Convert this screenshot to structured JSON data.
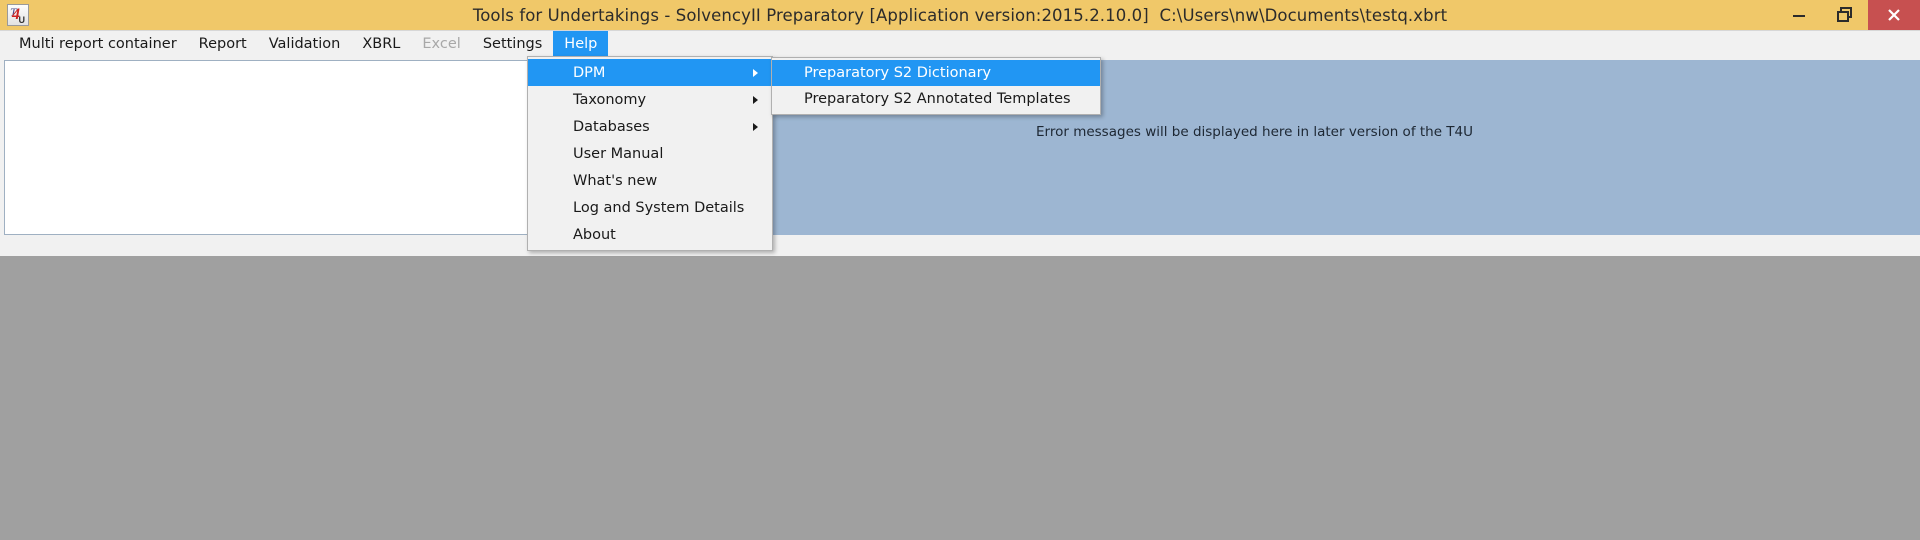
{
  "window": {
    "title": "Tools for Undertakings - SolvencyII Preparatory [Application version:2015.2.10.0]  C:\\Users\\nw\\Documents\\testq.xbrt",
    "icon_name": "t4u-app-icon",
    "icon_letters": {
      "t": "T",
      "four": "4",
      "u": "U"
    },
    "titlebar_color": "#f0c869",
    "controls": {
      "minimize_label": "Minimize",
      "restore_label": "Restore",
      "close_label": "Close",
      "close_color": "#c75050"
    }
  },
  "menubar": {
    "items": [
      {
        "label": "Multi report container",
        "state": "normal"
      },
      {
        "label": "Report",
        "state": "normal"
      },
      {
        "label": "Validation",
        "state": "normal"
      },
      {
        "label": "XBRL",
        "state": "normal"
      },
      {
        "label": "Excel",
        "state": "disabled"
      },
      {
        "label": "Settings",
        "state": "normal"
      },
      {
        "label": "Help",
        "state": "active"
      }
    ],
    "accent_color": "#2196f3"
  },
  "help_menu": {
    "items": [
      {
        "label": "DPM",
        "has_submenu": true,
        "highlighted": true
      },
      {
        "label": "Taxonomy",
        "has_submenu": true,
        "highlighted": false
      },
      {
        "label": "Databases",
        "has_submenu": true,
        "highlighted": false
      },
      {
        "label": "User Manual",
        "has_submenu": false,
        "highlighted": false
      },
      {
        "label": "What's new",
        "has_submenu": false,
        "highlighted": false
      },
      {
        "label": "Log and System Details",
        "has_submenu": false,
        "highlighted": false
      },
      {
        "label": "About",
        "has_submenu": false,
        "highlighted": false
      }
    ]
  },
  "dpm_submenu": {
    "items": [
      {
        "label": "Preparatory S2 Dictionary",
        "highlighted": true
      },
      {
        "label": "Preparatory S2 Annotated Templates",
        "highlighted": false
      }
    ]
  },
  "client": {
    "error_panel": {
      "message": "Error messages will be displayed here in later version of the T4U",
      "background_color": "#9db6d2"
    },
    "left_panel": {
      "background_color": "#ffffff"
    }
  }
}
